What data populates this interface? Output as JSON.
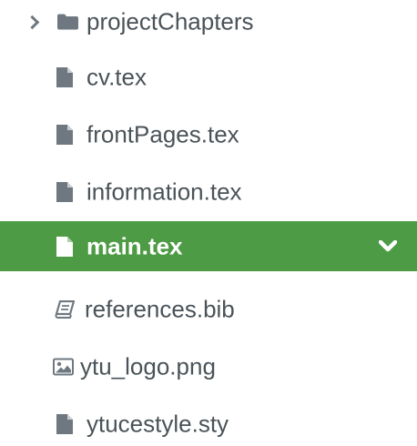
{
  "file_tree": {
    "items": [
      {
        "name": "projectChapters",
        "type": "folder",
        "icon": "folder-icon",
        "expanded": false
      },
      {
        "name": "cv.tex",
        "type": "file",
        "icon": "file-icon"
      },
      {
        "name": "frontPages.tex",
        "type": "file",
        "icon": "file-icon"
      },
      {
        "name": "information.tex",
        "type": "file",
        "icon": "file-icon"
      },
      {
        "name": "main.tex",
        "type": "file",
        "icon": "file-icon",
        "selected": true,
        "action_icon": "chevron-down-icon"
      },
      {
        "name": "references.bib",
        "type": "bib",
        "icon": "book-icon"
      },
      {
        "name": "ytu_logo.png",
        "type": "image",
        "icon": "image-icon"
      },
      {
        "name": "ytucestyle.sty",
        "type": "file",
        "icon": "file-icon"
      }
    ]
  },
  "colors": {
    "text": "#4a5358",
    "icon": "#6f7880",
    "selected_background": "#4d9b44",
    "selected_text": "#ffffff"
  }
}
